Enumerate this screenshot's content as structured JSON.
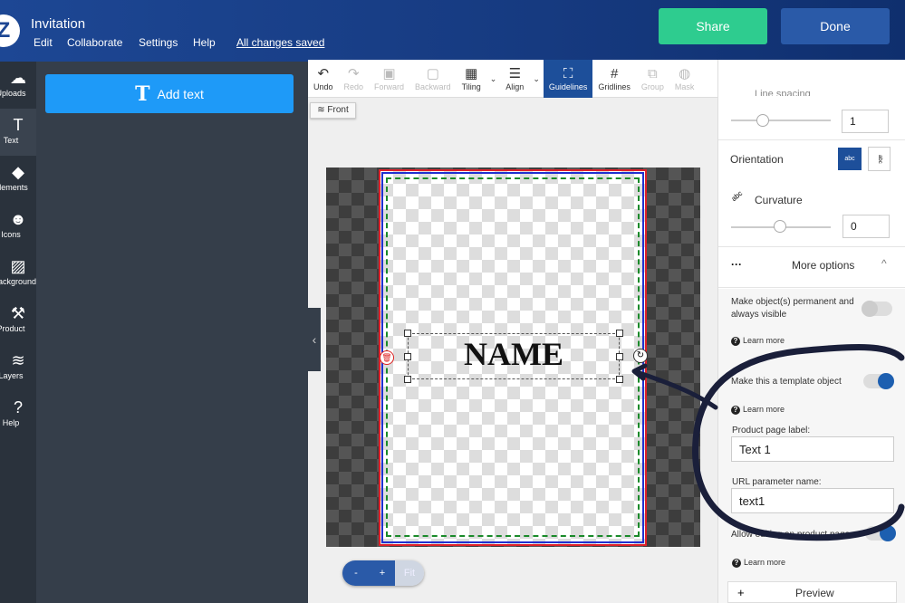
{
  "header": {
    "logo": "Z",
    "title": "Invitation",
    "menu": [
      "Edit",
      "Collaborate",
      "Settings",
      "Help"
    ],
    "saved_status": "All changes saved",
    "share_label": "Share",
    "done_label": "Done",
    "share_color": "#2ecc8f",
    "done_color": "#2a5aa8"
  },
  "rail": [
    {
      "label": "Uploads",
      "icon": "☁"
    },
    {
      "label": "Text",
      "icon": "T"
    },
    {
      "label": "Elements",
      "icon": "◆"
    },
    {
      "label": "Icons",
      "icon": "☻"
    },
    {
      "label": "Background",
      "icon": "▨"
    },
    {
      "label": "Product",
      "icon": "⚒"
    },
    {
      "label": "Layers",
      "icon": "≋"
    },
    {
      "label": "Help",
      "icon": "?"
    }
  ],
  "panel": {
    "add_text_label": "Add text"
  },
  "toolbar": [
    {
      "label": "Undo",
      "icon": "↶",
      "state": "normal"
    },
    {
      "label": "Redo",
      "icon": "↷",
      "state": "disabled"
    },
    {
      "label": "Forward",
      "icon": "▣",
      "state": "disabled"
    },
    {
      "label": "Backward",
      "icon": "▢",
      "state": "disabled"
    },
    {
      "label": "Tiling",
      "icon": "▦",
      "state": "normal",
      "dropdown": true
    },
    {
      "label": "Align",
      "icon": "☰",
      "state": "normal",
      "dropdown": true
    },
    {
      "label": "Guidelines",
      "icon": "⛶",
      "state": "active"
    },
    {
      "label": "Gridlines",
      "icon": "#",
      "state": "normal"
    },
    {
      "label": "Group",
      "icon": "⧉",
      "state": "disabled"
    },
    {
      "label": "Mask",
      "icon": "◍",
      "state": "disabled"
    }
  ],
  "canvas": {
    "side_label": "Front",
    "text_object": "NAME"
  },
  "zoom": {
    "minus": "-",
    "plus": "+",
    "fit": "Fit"
  },
  "right": {
    "line_spacing_label": "Line spacing",
    "line_spacing_value": "1",
    "line_spacing_slider": 0.3,
    "orientation_label": "Orientation",
    "orientation_options": [
      "abc",
      "abc"
    ],
    "orientation_selected": 0,
    "curvature_label": "Curvature",
    "curvature_value": "0",
    "curvature_slider": 0.5,
    "more_options_label": "More options",
    "permanent_label": "Make object(s) permanent and always visible",
    "permanent_on": false,
    "learn_more": "Learn more",
    "template_label": "Make this a template object",
    "template_on": true,
    "product_page_label": "Product page label:",
    "product_page_value": "Text 1",
    "url_param_label": "URL parameter name:",
    "url_param_value": "text1",
    "allow_editing_label": "Allow editing on product page",
    "allow_editing_on": true,
    "preview_label": "Preview"
  }
}
